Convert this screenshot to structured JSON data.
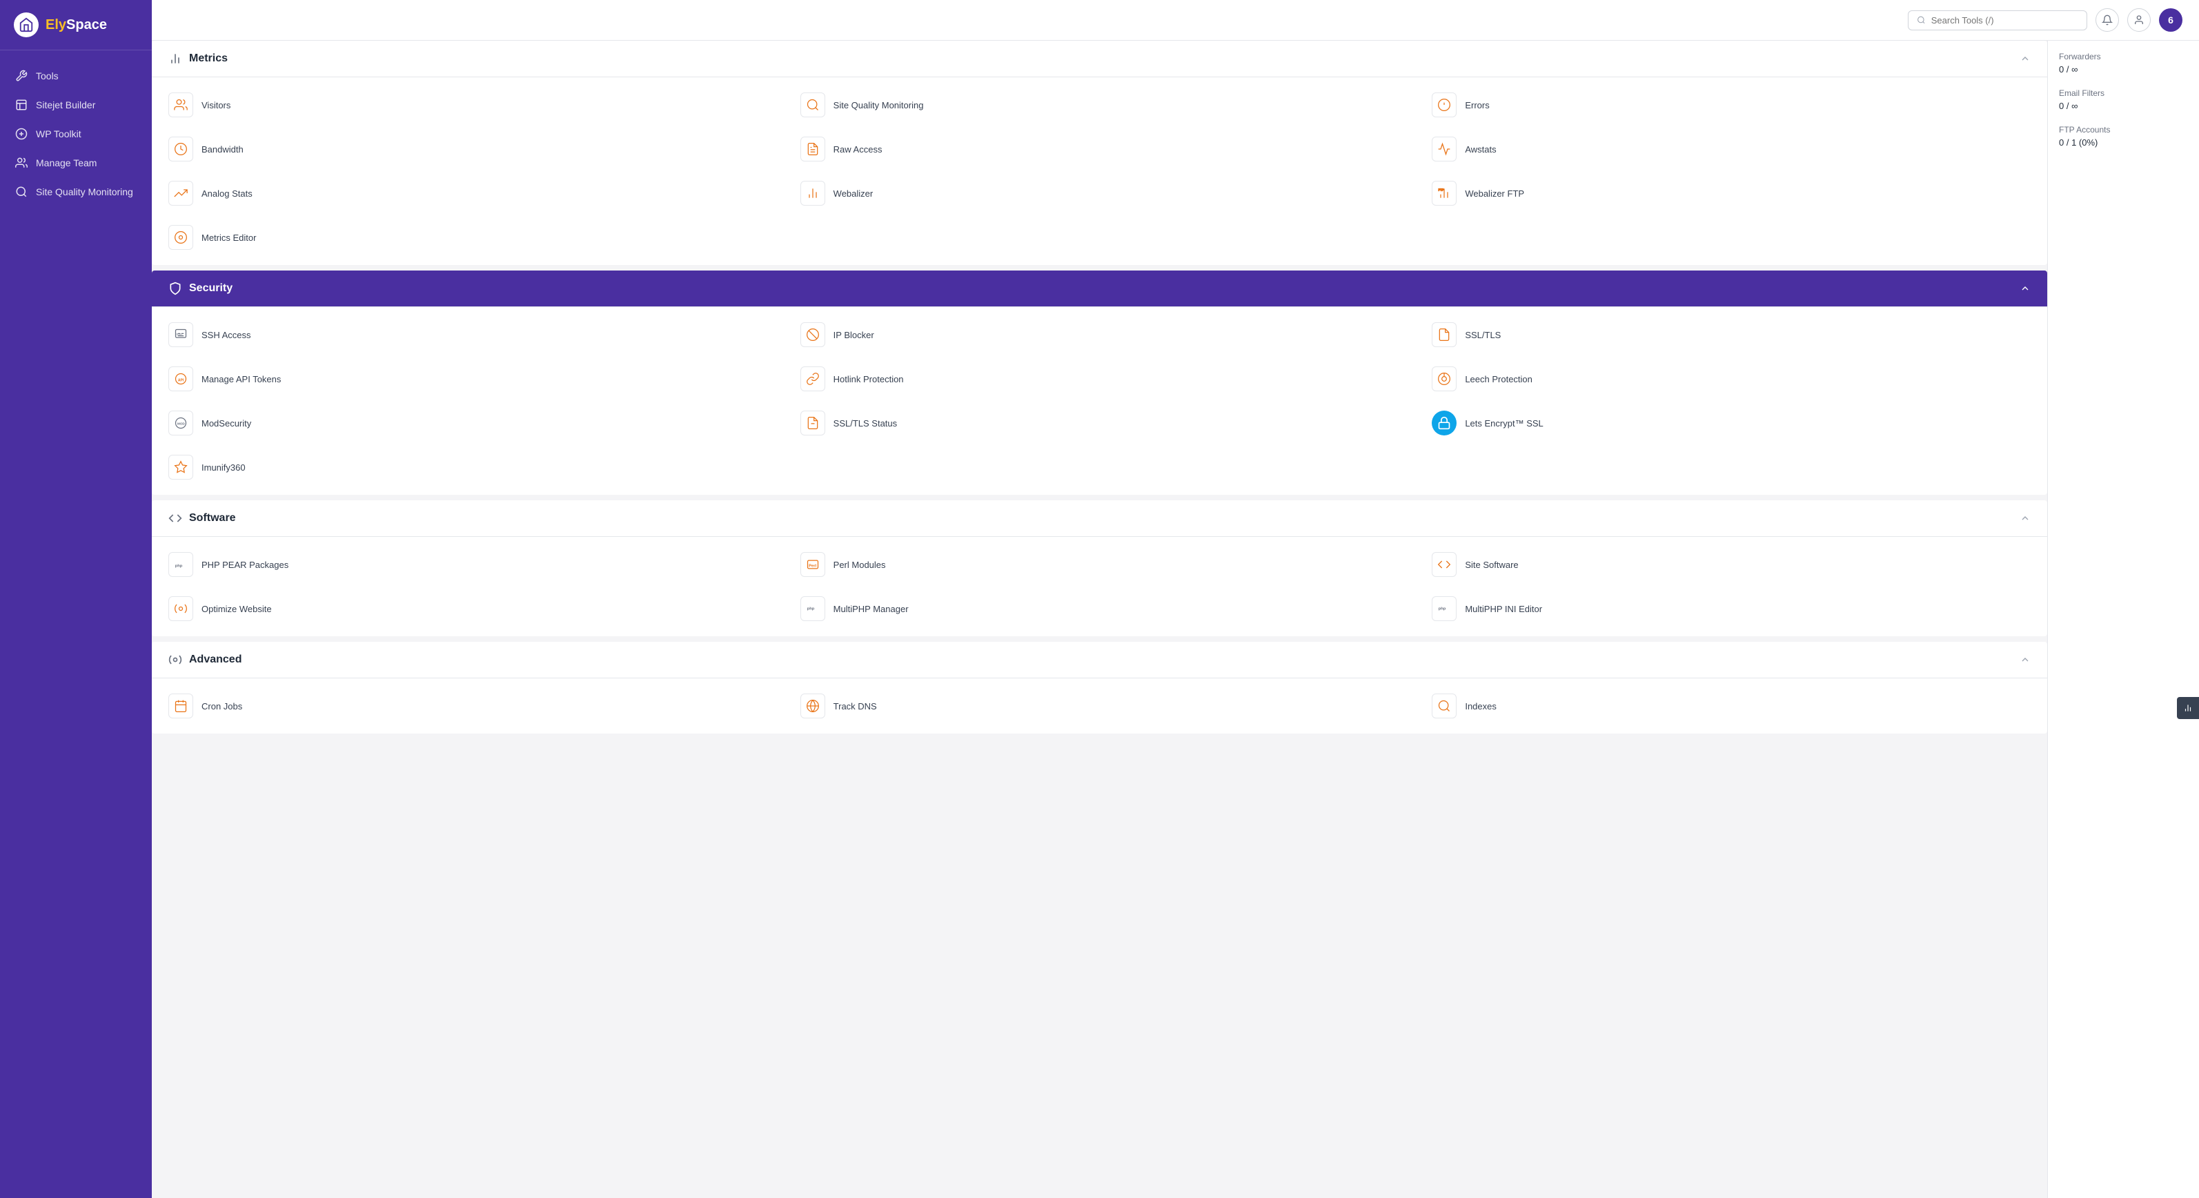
{
  "sidebar": {
    "logo_text_ely": "Ely",
    "logo_text_space": "Space",
    "items": [
      {
        "label": "Tools",
        "icon": "tools-icon",
        "active": false
      },
      {
        "label": "Sitejet Builder",
        "icon": "sitejet-icon",
        "active": false
      },
      {
        "label": "WP Toolkit",
        "icon": "wp-icon",
        "active": false
      },
      {
        "label": "Manage Team",
        "icon": "team-icon",
        "active": false
      },
      {
        "label": "Site Quality Monitoring",
        "icon": "monitor-icon",
        "active": false
      }
    ]
  },
  "header": {
    "search_placeholder": "Search Tools (/)",
    "notification_count": "6"
  },
  "sections": [
    {
      "id": "metrics",
      "label": "Metrics",
      "items": [
        {
          "label": "Visitors",
          "icon": "visitors-icon"
        },
        {
          "label": "Site Quality Monitoring",
          "icon": "sqm-icon"
        },
        {
          "label": "Errors",
          "icon": "errors-icon"
        },
        {
          "label": "Bandwidth",
          "icon": "bandwidth-icon"
        },
        {
          "label": "Raw Access",
          "icon": "raw-access-icon"
        },
        {
          "label": "Awstats",
          "icon": "awstats-icon"
        },
        {
          "label": "Analog Stats",
          "icon": "analog-stats-icon"
        },
        {
          "label": "Webalizer",
          "icon": "webalizer-icon"
        },
        {
          "label": "Webalizer FTP",
          "icon": "webalizer-ftp-icon"
        },
        {
          "label": "Metrics Editor",
          "icon": "metrics-editor-icon"
        }
      ]
    },
    {
      "id": "security",
      "label": "Security",
      "highlighted": true,
      "items": [
        {
          "label": "SSH Access",
          "icon": "ssh-icon"
        },
        {
          "label": "IP Blocker",
          "icon": "ip-blocker-icon"
        },
        {
          "label": "SSL/TLS",
          "icon": "ssl-icon"
        },
        {
          "label": "Manage API Tokens",
          "icon": "api-icon"
        },
        {
          "label": "Hotlink Protection",
          "icon": "hotlink-icon"
        },
        {
          "label": "Leech Protection",
          "icon": "leech-icon"
        },
        {
          "label": "ModSecurity",
          "icon": "modsec-icon"
        },
        {
          "label": "SSL/TLS Status",
          "icon": "ssl-status-icon"
        },
        {
          "label": "Lets Encrypt™ SSL",
          "icon": "letsencrypt-icon"
        },
        {
          "label": "Imunify360",
          "icon": "imunify-icon"
        }
      ]
    },
    {
      "id": "software",
      "label": "Software",
      "items": [
        {
          "label": "PHP PEAR Packages",
          "icon": "php-pear-icon"
        },
        {
          "label": "Perl Modules",
          "icon": "perl-icon"
        },
        {
          "label": "Site Software",
          "icon": "site-software-icon"
        },
        {
          "label": "Optimize Website",
          "icon": "optimize-icon"
        },
        {
          "label": "MultiPHP Manager",
          "icon": "multiphp-icon"
        },
        {
          "label": "MultiPHP INI Editor",
          "icon": "multiphp-ini-icon"
        }
      ]
    },
    {
      "id": "advanced",
      "label": "Advanced",
      "items": [
        {
          "label": "Cron Jobs",
          "icon": "cron-icon"
        },
        {
          "label": "Track DNS",
          "icon": "dns-icon"
        },
        {
          "label": "Indexes",
          "icon": "indexes-icon"
        }
      ]
    }
  ],
  "right_panel": {
    "items": [
      {
        "label": "Forwarders",
        "value": "0 / ∞"
      },
      {
        "label": "Email Filters",
        "value": "0 / ∞"
      },
      {
        "label": "FTP Accounts",
        "value": "0 / 1  (0%)"
      }
    ]
  }
}
